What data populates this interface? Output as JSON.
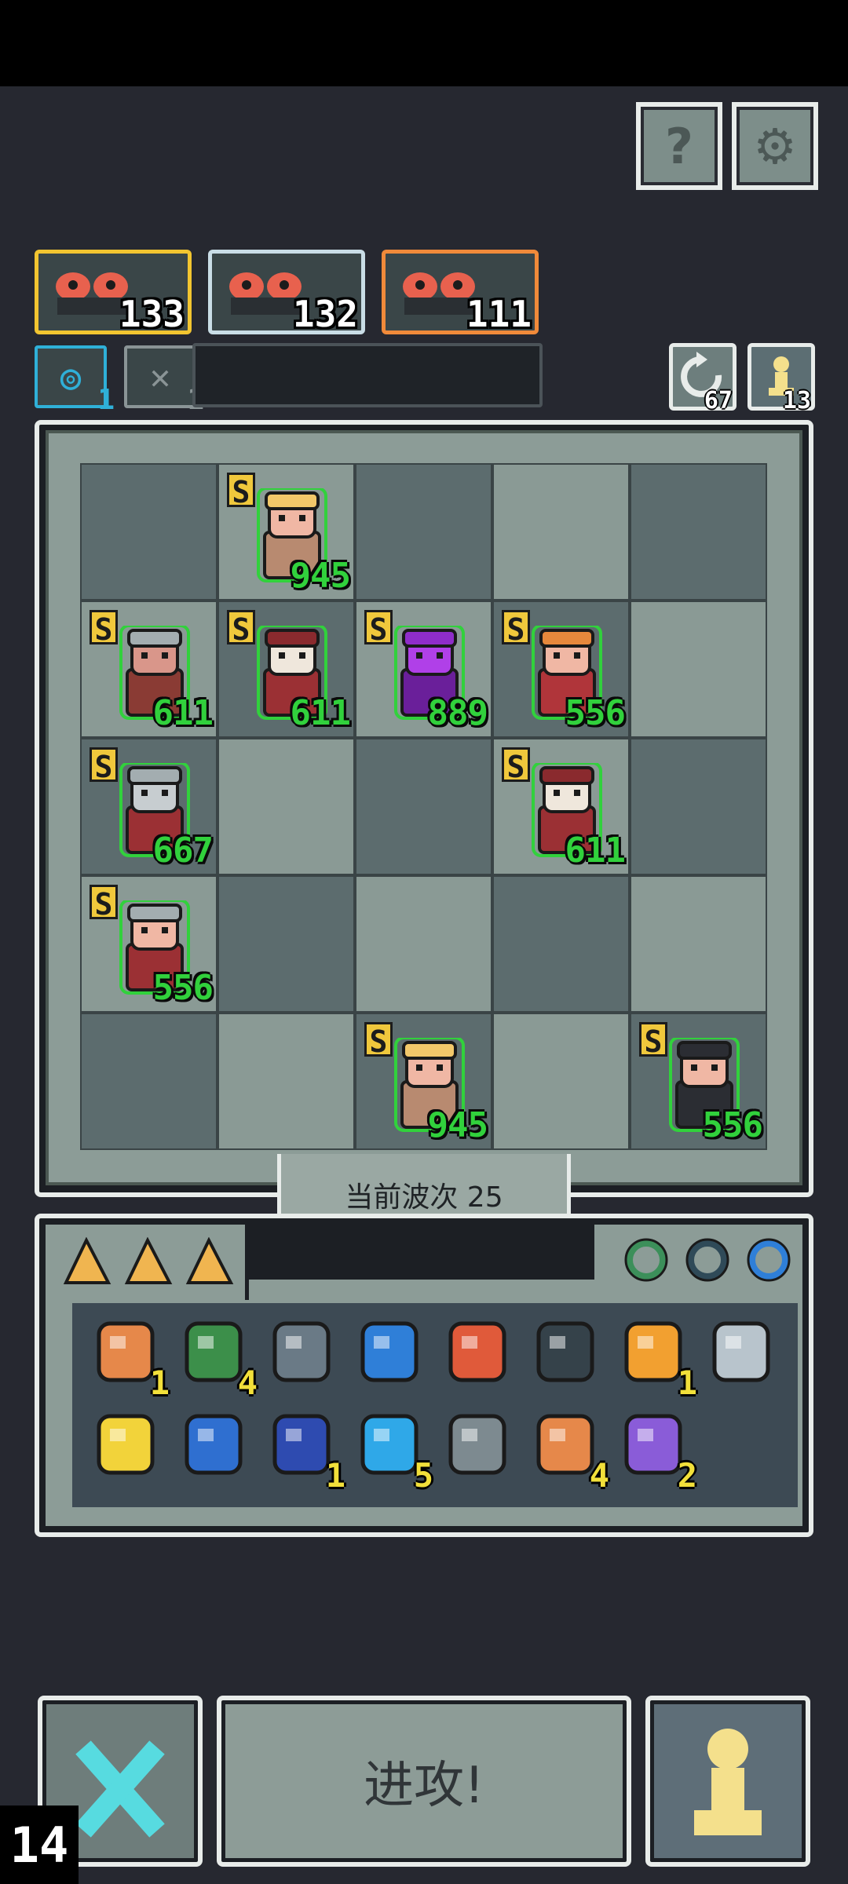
{
  "hud": {
    "help_icon": "question-icon",
    "settings_icon": "gear-icon"
  },
  "opponents": [
    {
      "value": "133",
      "color": "#f2c530"
    },
    {
      "value": "132",
      "color": "#c9dde6"
    },
    {
      "value": "111",
      "color": "#f08a3a"
    }
  ],
  "buffs": [
    {
      "icon": "clock-shield-icon",
      "count": "1",
      "color": "#2fb0d8"
    },
    {
      "icon": "crossed-swords-icon",
      "count": "1",
      "color": "#8a9496"
    }
  ],
  "resources": {
    "refresh": {
      "icon": "refresh-icon",
      "value": "67"
    },
    "pawn": {
      "icon": "pawn-icon",
      "value": "13"
    }
  },
  "board": {
    "rows": [
      [
        null,
        {
          "rank": "S",
          "hp": "945",
          "kind": "blonde"
        },
        null,
        null,
        null
      ],
      [
        {
          "rank": "S",
          "hp": "611",
          "kind": "knight-shield"
        },
        {
          "rank": "S",
          "hp": "611",
          "kind": "red-hat"
        },
        {
          "rank": "S",
          "hp": "889",
          "kind": "purple-knight"
        },
        {
          "rank": "S",
          "hp": "556",
          "kind": "crowned"
        },
        null
      ],
      [
        {
          "rank": "S",
          "hp": "667",
          "kind": "knight"
        },
        null,
        null,
        {
          "rank": "S",
          "hp": "611",
          "kind": "red-hat"
        },
        null
      ],
      [
        {
          "rank": "S",
          "hp": "556",
          "kind": "helmet-soldier"
        },
        null,
        null,
        null,
        null
      ],
      [
        null,
        null,
        {
          "rank": "S",
          "hp": "945",
          "kind": "blonde"
        },
        null,
        {
          "rank": "S",
          "hp": "556",
          "kind": "bearded"
        }
      ]
    ]
  },
  "wave": {
    "label": "当前波次 25"
  },
  "inventory": {
    "tabs": [
      {
        "icon": "cheese-icon"
      },
      {
        "icon": "cheese-icon"
      },
      {
        "icon": "cheese-icon"
      }
    ],
    "rings": [
      {
        "icon": "green-ring-icon"
      },
      {
        "icon": "dark-ring-icon"
      },
      {
        "icon": "blue-amulet-icon"
      }
    ],
    "items_row1": [
      {
        "icon": "lantern-icon",
        "count": "1"
      },
      {
        "icon": "zombie-hand-icon",
        "count": "4"
      },
      {
        "icon": "shield-icon",
        "count": ""
      },
      {
        "icon": "potion-jar-icon",
        "count": ""
      },
      {
        "icon": "coral-icon",
        "count": ""
      },
      {
        "icon": "phone-icon",
        "count": ""
      },
      {
        "icon": "orb-ring-icon",
        "count": "1"
      },
      {
        "icon": "feather-coin-icon",
        "count": ""
      }
    ],
    "items_row2": [
      {
        "icon": "chalice-icon",
        "count": ""
      },
      {
        "icon": "water-drop-frame-icon",
        "count": ""
      },
      {
        "icon": "hourglass-icon",
        "count": "1"
      },
      {
        "icon": "blue-orb-icon",
        "count": "5"
      },
      {
        "icon": "shuriken-icon",
        "count": ""
      },
      {
        "icon": "horn-icon",
        "count": "4"
      },
      {
        "icon": "jar-icon",
        "count": "2"
      }
    ]
  },
  "actions": {
    "sell_icon": "cross-icon",
    "attack_label": "进攻!",
    "pawn_icon": "pawn-icon"
  },
  "corner_label": "14"
}
